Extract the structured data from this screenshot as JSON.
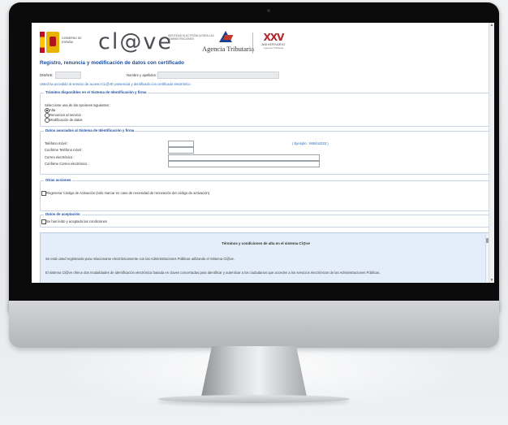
{
  "header": {
    "gobierno_text": "GOBIERNO DE ESPAÑA",
    "clave_logo": "cl@ve",
    "clave_subtitle": "Identidad electrónica para las administraciones",
    "aeat_name": "Agencia Tributaria",
    "anniversary_roman": "XXV",
    "anniversary_label": "ANIVERSARIO",
    "anniversary_sub": "Agencia Tributaria"
  },
  "page": {
    "title": "Registro, renuncia y modificación de datos con certificado",
    "dni_label": "DNI/NIE:",
    "name_label": "Nombre y apellidos:",
    "notice": "Usted ha accedido al servicio de acceso CL@VE presencial y dentificado con certificado electrónico"
  },
  "tramites": {
    "legend": "Trámites disponibles en el Sistema de Identificación y firma",
    "intro": "Seleccione una de las opciones siguientes :",
    "options": [
      {
        "label": "Alta",
        "selected": true
      },
      {
        "label": "Renunciar al servicio",
        "selected": false
      },
      {
        "label": "Modificación de datos",
        "selected": false
      }
    ]
  },
  "datos": {
    "legend": "Datos asociados al Sistema de Identificación y firma",
    "telefono_label": "Teléfono móvil :",
    "confirm_telefono_label": "Confirme Teléfono móvil :",
    "correo_label": "Correo electrónico :",
    "confirm_correo_label": "Confirme Correo electrónico :",
    "example": "( Ejemplo : 666444333 )"
  },
  "otras": {
    "legend": "Otras acciones",
    "regen_label": "Regenerar Código de Activación (solo marcar en caso de necesidad de renovación del código de activación)"
  },
  "aceptacion": {
    "legend": "Datos de aceptación",
    "accept_label": "Se han leído y aceptado las condiciones"
  },
  "terms": {
    "title": "Términos y condiciones de alta en el sistema Cl@ve",
    "p1": "Se está usted registrando para relacionarse electrónicamente con las Administraciones Públicas utilizando el Sistema Cl@ve.",
    "p2": "El sistema Cl@ve ofrece dos modalidades de identificación electrónica basada en claves concertadas para identificar y autenticar a los ciudadanos que acceden a los servicios electrónicos de las Administraciones Públicas."
  },
  "colors": {
    "accent": "#1f4fa0",
    "link": "#2a6ebd",
    "clave_orange": "#e86a2c"
  }
}
